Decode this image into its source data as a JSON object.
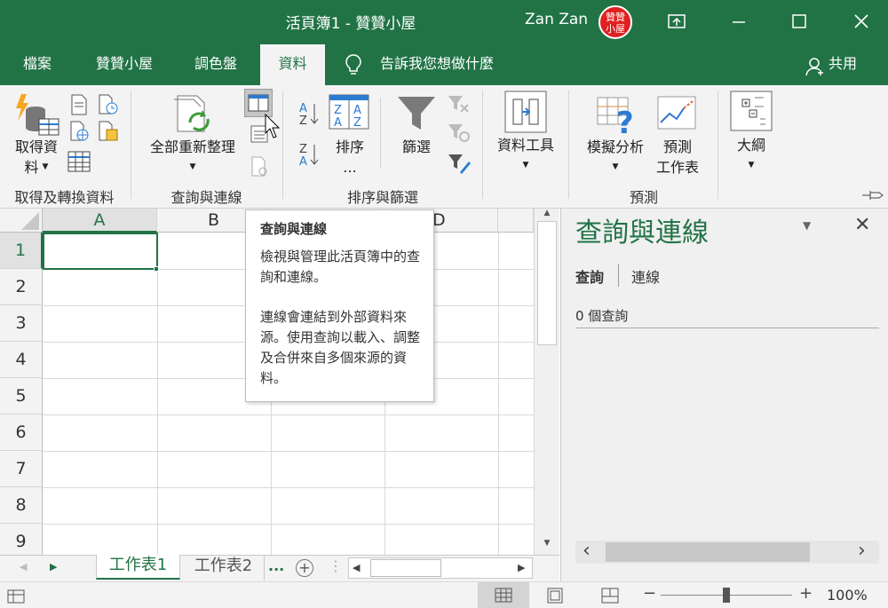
{
  "window": {
    "title": "活頁簿1  -  贊贊小屋",
    "user_name": "Zan Zan",
    "avatar_text": "贊贊小屋"
  },
  "menu": {
    "tabs": [
      "檔案",
      "贊贊小屋",
      "調色盤",
      "資料",
      "告訴我您想做什麼"
    ],
    "active_tab": "資料",
    "share_label": "共用"
  },
  "ribbon": {
    "get_data_label1": "取得資",
    "get_data_label2": "料",
    "group_get": "取得及轉換資料",
    "refresh_all_label": "全部重新整理",
    "group_queries": "查詢與連線",
    "sort_label": "排序",
    "sort_more": "...",
    "filter_label": "篩選",
    "group_sortfilter": "排序與篩選",
    "data_tools_label": "資料工具",
    "whatif_label": "模擬分析",
    "forecast_label1": "預測",
    "forecast_label2": "工作表",
    "group_forecast": "預測",
    "outline_label": "大綱"
  },
  "grid": {
    "columns": [
      "A",
      "B",
      "C",
      "D"
    ],
    "rows": [
      "1",
      "2",
      "3",
      "4",
      "5",
      "6",
      "7",
      "8",
      "9"
    ]
  },
  "tooltip": {
    "title": "查詢與連線",
    "para1": "檢視與管理此活頁簿中的查詢和連線。",
    "para2": "連線會連結到外部資料來源。使用查詢以載入、調整及合併來自多個來源的資料。"
  },
  "pane": {
    "title": "查詢與連線",
    "tab_queries": "查詢",
    "tab_connections": "連線",
    "count_text": "0 個查詢"
  },
  "sheets": {
    "tabs": [
      "工作表1",
      "工作表2"
    ],
    "active": "工作表1",
    "more": "..."
  },
  "status": {
    "zoom": "100%",
    "zoom_level": 1.0
  },
  "colors": {
    "accent": "#217346",
    "ribbon_bg": "#f3f3f3",
    "avatar": "#e02020"
  }
}
